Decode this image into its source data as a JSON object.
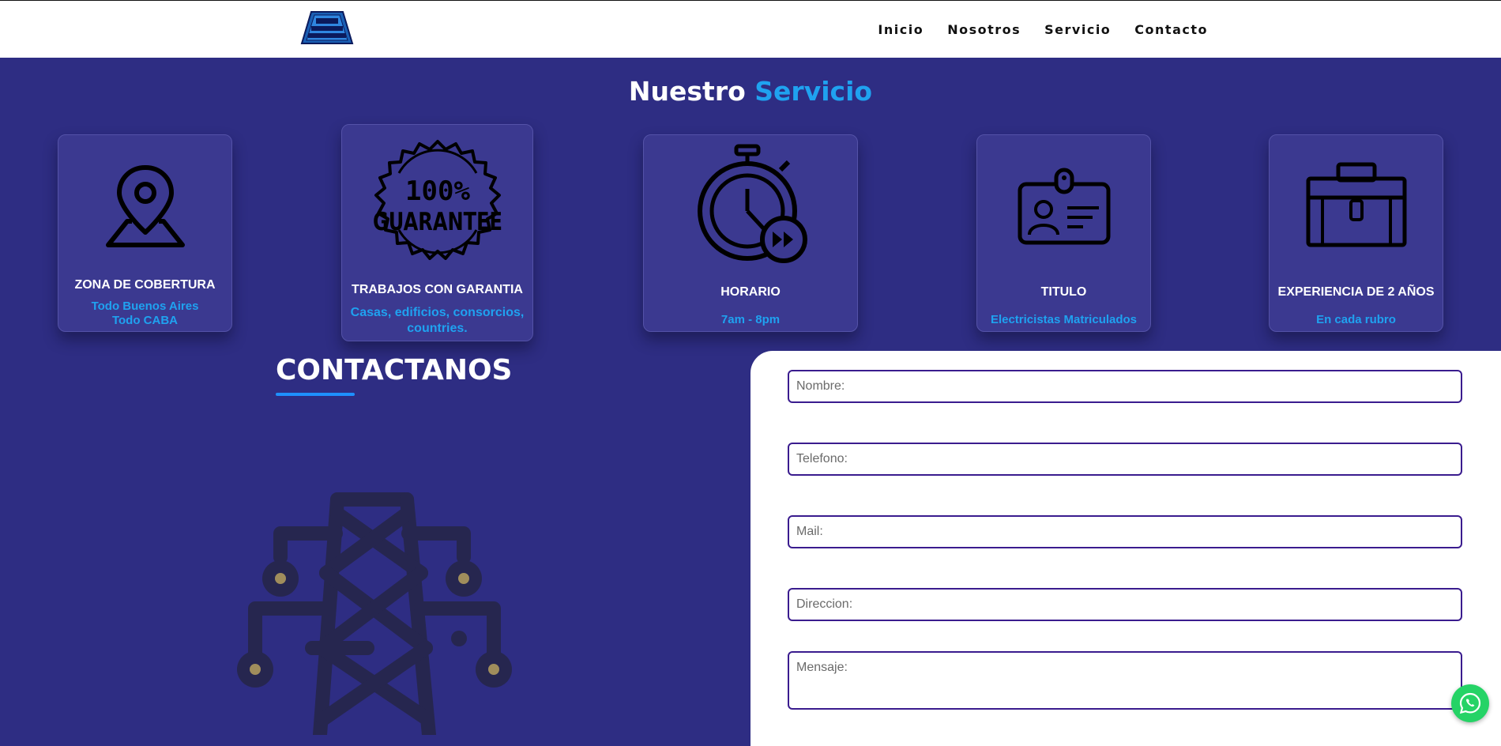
{
  "header": {
    "logo_alt": "logo",
    "nav": [
      "Inicio",
      "Nosotros",
      "Servicio",
      "Contacto"
    ]
  },
  "servicio": {
    "title_part1": "Nuestro",
    "title_part2": "Servicio",
    "cards": [
      {
        "icon": "location-pin-icon",
        "title": "ZONA DE COBERTURA",
        "line1": "Todo Buenos Aires",
        "line2": "Todo CABA"
      },
      {
        "icon": "guarantee-badge-icon",
        "badge_text_1": "100%",
        "badge_text_2": "GUARANTEE",
        "title": "TRABAJOS CON GARANTIA",
        "line1": "Casas, edificios, consorcios,",
        "line2": "countries."
      },
      {
        "icon": "stopwatch-icon",
        "title": "HORARIO",
        "line1": "7am - 8pm"
      },
      {
        "icon": "id-badge-icon",
        "title": "TITULO",
        "line1": "Electricistas Matriculados"
      },
      {
        "icon": "briefcase-icon",
        "title": "EXPERIENCIA DE 2 AÑOS",
        "line1": "En cada rubro"
      }
    ]
  },
  "contact": {
    "title": "CONTACTANOS",
    "fields": {
      "nombre": "Nombre:",
      "telefono": "Telefono:",
      "mail": "Mail:",
      "direccion": "Direccion:",
      "mensaje": "Mensaje:"
    }
  },
  "colors": {
    "background": "#2e2d83",
    "accent": "#1fa2f0",
    "card": "#3b3990",
    "field_border": "#3a1c8e",
    "whatsapp": "#25d366"
  }
}
